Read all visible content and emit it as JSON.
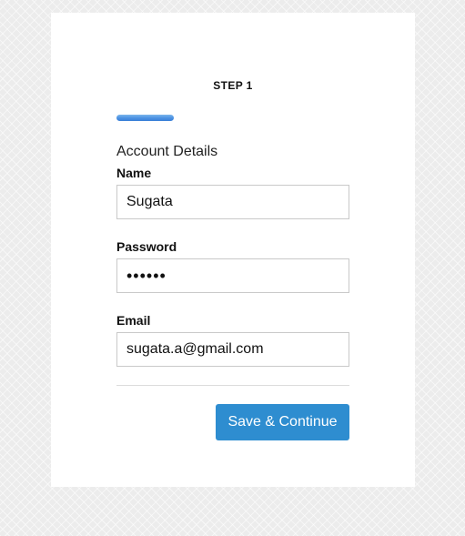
{
  "step": {
    "title": "STEP 1",
    "progress": 0.25
  },
  "section": {
    "title": "Account Details"
  },
  "fields": {
    "name": {
      "label": "Name",
      "value": "Sugata"
    },
    "password": {
      "label": "Password",
      "value": "••••••"
    },
    "email": {
      "label": "Email",
      "value": "sugata.a@gmail.com"
    }
  },
  "actions": {
    "save_label": "Save & Continue"
  },
  "colors": {
    "accent": "#2e8dd0",
    "progress": "#4a90e2"
  }
}
